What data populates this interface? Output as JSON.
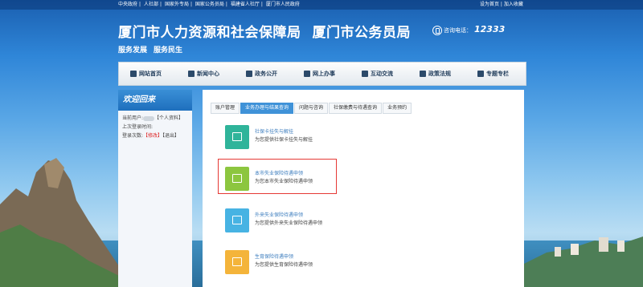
{
  "topbar": {
    "links": [
      "中央政府",
      "|",
      "人社部",
      "|",
      "国家外专局",
      "|",
      "国家公务员局",
      "|",
      "福建省人社厅",
      "|",
      "厦门市人民政府"
    ],
    "right": "设为首页 | 加入收藏"
  },
  "header": {
    "title1": "厦门市人力资源和社会保障局",
    "title2": "厦门市公务员局",
    "slogans": [
      "服务发展",
      "服务民生"
    ],
    "hotline_label": "咨询电话：",
    "hotline_number": "12333"
  },
  "nav": {
    "items": [
      {
        "label": "网站首页",
        "icon": "home-icon"
      },
      {
        "label": "新闻中心",
        "icon": "eye-icon"
      },
      {
        "label": "政务公开",
        "icon": "document-icon"
      },
      {
        "label": "网上办事",
        "icon": "monitor-icon"
      },
      {
        "label": "互动交流",
        "icon": "chat-icon"
      },
      {
        "label": "政策法规",
        "icon": "book-icon"
      },
      {
        "label": "专题专栏",
        "icon": "star-icon"
      }
    ]
  },
  "sidebar": {
    "welcome": "欢迎回来",
    "current_user_label": "当前用户:",
    "profile_link": "【个人资料】",
    "last_login_label": "上次登录时间:",
    "login_count_label": "登录次数:",
    "change_link": "【修改】",
    "logout_link": "【退出】"
  },
  "tabs": [
    {
      "label": "账户管理",
      "active": false
    },
    {
      "label": "业务办理与结果查询",
      "active": true
    },
    {
      "label": "问题与咨询",
      "active": false
    },
    {
      "label": "社保缴费与待遇查询",
      "active": false
    },
    {
      "label": "业务预约",
      "active": false
    }
  ],
  "services": [
    {
      "name": "社保卡挂失与解挂",
      "desc": "为您提供社保卡挂失与解挂",
      "color": "#2fb49a",
      "icon": "briefcase-icon"
    },
    {
      "name": "本市失业保险待遇申领",
      "desc": "为您本市失业保险待遇申领",
      "color": "#8cc63f",
      "icon": "folder-icon"
    },
    {
      "name": "外来失业保险待遇申领",
      "desc": "为您提供外来失业保险待遇申领",
      "color": "#47b3e3",
      "icon": "file-icon"
    },
    {
      "name": "生育保险待遇申领",
      "desc": "为您提供生育保险待遇申领",
      "color": "#f4b43a",
      "icon": "family-icon"
    }
  ],
  "colors": {
    "accent": "#3f92d8",
    "highlight": "#e53935"
  }
}
